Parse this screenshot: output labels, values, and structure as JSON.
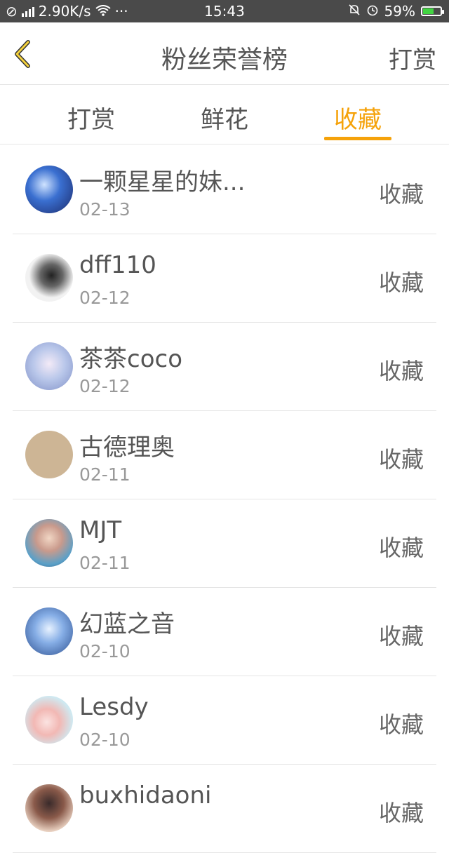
{
  "status_bar": {
    "speed": "2.90K/s",
    "dots": "···",
    "time": "15:43",
    "battery": "59%",
    "battery_level": 0.59
  },
  "header": {
    "title": "粉丝荣誉榜",
    "action": "打赏"
  },
  "tabs": [
    {
      "label": "打赏"
    },
    {
      "label": "鲜花"
    },
    {
      "label": "收藏",
      "active": true
    }
  ],
  "list": [
    {
      "name": "一颗星星的妹...",
      "date": "02-13",
      "action": "收藏"
    },
    {
      "name": "dff110",
      "date": "02-12",
      "action": "收藏"
    },
    {
      "name": "茶茶coco",
      "date": "02-12",
      "action": "收藏"
    },
    {
      "name": "古德理奥",
      "date": "02-11",
      "action": "收藏"
    },
    {
      "name": "MJT",
      "date": "02-11",
      "action": "收藏"
    },
    {
      "name": "幻蓝之音",
      "date": "02-10",
      "action": "收藏"
    },
    {
      "name": "Lesdy",
      "date": "02-10",
      "action": "收藏"
    },
    {
      "name": "buxhidaoni",
      "date": "",
      "action": "收藏"
    }
  ],
  "colors": {
    "accent": "#f5a20a",
    "status_bar": "#4a4a4a"
  }
}
